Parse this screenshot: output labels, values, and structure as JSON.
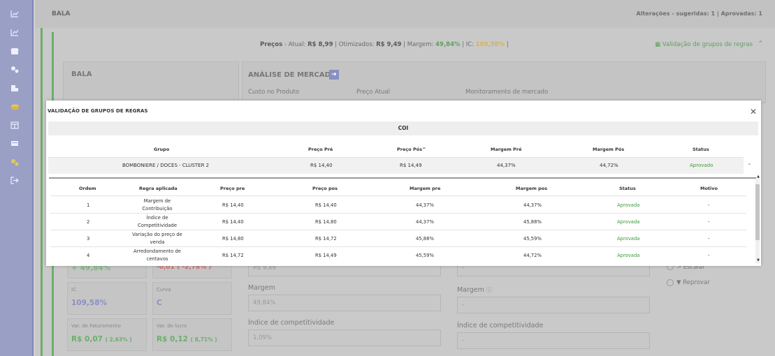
{
  "sidebar": {
    "icons": [
      "chart-line-icon",
      "chart-area-icon",
      "store-icon",
      "settings-icon",
      "building-icon",
      "coins-icon",
      "table-icon",
      "card-icon",
      "gears-icon",
      "logout-icon"
    ]
  },
  "background": {
    "title": "BALA",
    "top_right": "Alterações - sugeridas: 1 | Aprovadas: 1",
    "prices": {
      "label": "Preços",
      "atual_label": "- Atual:",
      "atual": "R$ 8,99",
      "otim_label": "| Otimizados:",
      "otim": "R$ 9,49",
      "margem_label": "| Margem:",
      "margem": "49,84%",
      "ic_label": "| IC:",
      "ic": "109,58%",
      "tail": "|"
    },
    "validation_link": "Validação de grupos de regras",
    "card_bala_title": "BALA",
    "market_title": "ANÁLISE DE MERCADO",
    "custo_label": "Custo no Produto",
    "preco_atual_label": "Preço Atual",
    "monitor_label": "Monitoramento de mercado",
    "small_cards": [
      {
        "label": "",
        "value": "+ 49,84%"
      },
      {
        "label": "",
        "value": "-0,01 ( -2,78% )"
      },
      {
        "label": "IC",
        "value": "109,58%"
      },
      {
        "label": "Curva",
        "value": "C"
      },
      {
        "label": "Var. de Faturamento",
        "value": "R$ 0,07",
        "sub": "( 2,63% )"
      },
      {
        "label": "Var. de lucro",
        "value": "R$ 0,12",
        "sub": "( 8,71% )"
      }
    ],
    "middle": {
      "preco_value": "R$ 9,49",
      "margem_label": "Margem",
      "margem_value": "49,84%",
      "indice_label": "Índice de competitividade",
      "indice_value": "1,09%"
    },
    "right": {
      "top_value": "-",
      "margem_label": "Margem",
      "margem_value": "-",
      "indice_label": "Índice de competitividade",
      "indice_value": "-"
    },
    "actions": {
      "escalar": "Escalar",
      "reprovar": "Reprovar"
    }
  },
  "modal": {
    "title": "VALIDAÇÃO DE GRUPOS DE REGRAS",
    "section": "COI",
    "group_headers": [
      "Grupo",
      "Preço Pré",
      "Preço Pós^",
      "Margem Pré",
      "Margem Pós",
      "Status"
    ],
    "group_row": {
      "grupo": "BOMBONIERE / DOCES - CLUSTER 2",
      "preco_pre": "R$ 14,40",
      "preco_pos": "R$ 14,49",
      "margem_pre": "44,37%",
      "margem_pos": "44,72%",
      "status": "Aprovado"
    },
    "rule_headers": [
      "Ordem",
      "Regra aplicada",
      "Preço pre",
      "Preço pos",
      "Margem pre",
      "Margem pos",
      "Status",
      "Motivo"
    ],
    "rules": [
      {
        "ordem": "1",
        "regra1": "Margem de",
        "regra2": "Contribuição",
        "preco_pre": "R$ 14,40",
        "preco_pos": "R$ 14,40",
        "margem_pre": "44,37%",
        "margem_pos": "44,37%",
        "status": "Aprovada",
        "motivo": "-"
      },
      {
        "ordem": "2",
        "regra1": "Índice de",
        "regra2": "Competitividade",
        "preco_pre": "R$ 14,40",
        "preco_pos": "R$ 14,80",
        "margem_pre": "44,37%",
        "margem_pos": "45,88%",
        "status": "Aprovada",
        "motivo": "-"
      },
      {
        "ordem": "3",
        "regra1": "Variação do preço de",
        "regra2": "venda",
        "preco_pre": "R$ 14,80",
        "preco_pos": "R$ 14,72",
        "margem_pre": "45,88%",
        "margem_pos": "45,59%",
        "status": "Aprovada",
        "motivo": "-"
      },
      {
        "ordem": "4",
        "regra1": "Arredondamento de",
        "regra2": "centavos",
        "preco_pre": "R$ 14,72",
        "preco_pos": "R$ 14,49",
        "margem_pre": "45,59%",
        "margem_pos": "44,72%",
        "status": "Aprovada",
        "motivo": "-"
      }
    ]
  },
  "colors": {
    "sidebar": "#9a9fc6",
    "accent_green": "#5f9f5e",
    "approved": "#3a9a3a",
    "ic_yellow": "#d8b449"
  }
}
